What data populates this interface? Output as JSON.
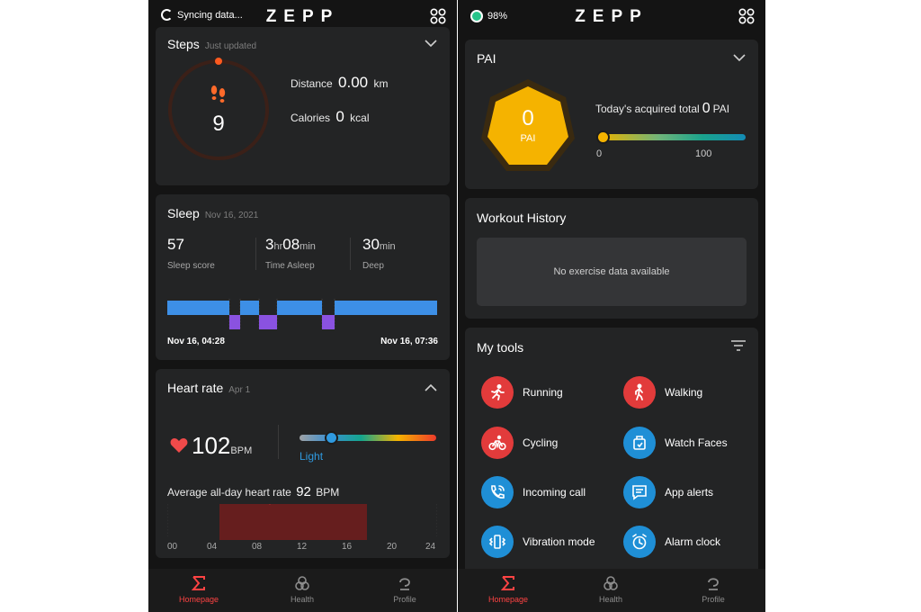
{
  "left": {
    "sync_text": "Syncing data...",
    "brand": "ZEPP",
    "steps": {
      "title": "Steps",
      "subtitle": "Just updated",
      "count": "9",
      "distance_label": "Distance",
      "distance_value": "0.00",
      "distance_unit": "km",
      "calories_label": "Calories",
      "calories_value": "0",
      "calories_unit": "kcal"
    },
    "sleep": {
      "title": "Sleep",
      "date": "Nov 16, 2021",
      "score": "57",
      "score_label": "Sleep score",
      "hours": "3",
      "hours_unit": "hr",
      "minutes": "08",
      "minutes_unit": "min",
      "time_label": "Time Asleep",
      "deep": "30",
      "deep_unit": "min",
      "deep_label": "Deep",
      "start": "Nov 16, 04:28",
      "end": "Nov 16, 07:36"
    },
    "heart": {
      "title": "Heart rate",
      "date": "Apr 1",
      "value": "102",
      "unit": "BPM",
      "zone": "Light",
      "avg_label": "Average all-day heart rate",
      "avg_value": "92",
      "avg_unit": "BPM",
      "axis": [
        "00",
        "04",
        "08",
        "12",
        "16",
        "20",
        "24"
      ]
    },
    "nav": {
      "home": "Homepage",
      "health": "Health",
      "profile": "Profile"
    }
  },
  "right": {
    "battery": "98%",
    "brand": "ZEPP",
    "pai": {
      "title": "PAI",
      "value": "0",
      "unit": "PAI",
      "today_label": "Today's acquired total",
      "today_value": "0",
      "today_unit": "PAI",
      "min": "0",
      "max": "100"
    },
    "workout": {
      "title": "Workout History",
      "empty": "No exercise data available"
    },
    "tools": {
      "title": "My tools",
      "items": [
        {
          "label": "Running",
          "icon": "running-icon",
          "color": "#e23b3b"
        },
        {
          "label": "Walking",
          "icon": "walking-icon",
          "color": "#e23b3b"
        },
        {
          "label": "Cycling",
          "icon": "cycling-icon",
          "color": "#e23b3b"
        },
        {
          "label": "Watch Faces",
          "icon": "watch-faces-icon",
          "color": "#1f8fd6"
        },
        {
          "label": "Incoming call",
          "icon": "phone-icon",
          "color": "#1f8fd6"
        },
        {
          "label": "App alerts",
          "icon": "message-icon",
          "color": "#1f8fd6"
        },
        {
          "label": "Vibration mode",
          "icon": "vibration-icon",
          "color": "#1f8fd6"
        },
        {
          "label": "Alarm clock",
          "icon": "alarm-clock-icon",
          "color": "#1f8fd6"
        }
      ]
    },
    "nav": {
      "home": "Homepage",
      "health": "Health",
      "profile": "Profile"
    }
  },
  "colors": {
    "accent_red": "#ff4343",
    "card": "#232425",
    "background": "#141414"
  }
}
